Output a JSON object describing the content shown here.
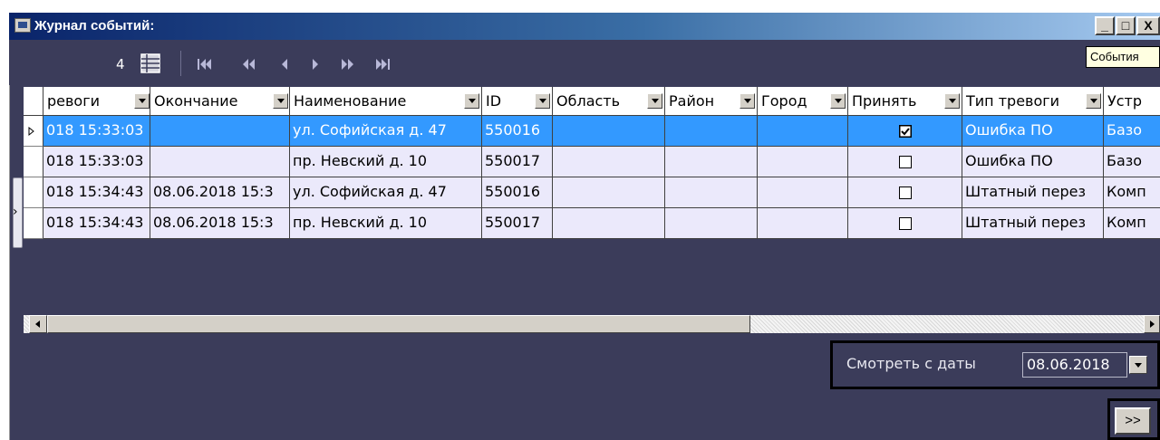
{
  "window": {
    "title": "Журнал событий:",
    "minimize_label": "_",
    "maximize_label": "□",
    "close_label": "X",
    "tooltip": "События"
  },
  "toolbar": {
    "record_count": "4",
    "nav_icons": [
      "first-record-icon",
      "prev-page-icon",
      "prev-record-icon",
      "next-record-icon",
      "next-page-icon",
      "last-record-icon"
    ]
  },
  "columns": [
    {
      "label": "ревоги",
      "has_dropdown": true
    },
    {
      "label": "Окончание",
      "has_dropdown": true
    },
    {
      "label": "Наименование",
      "has_dropdown": true
    },
    {
      "label": "ID",
      "has_dropdown": true
    },
    {
      "label": "Область",
      "has_dropdown": true
    },
    {
      "label": "Район",
      "has_dropdown": true
    },
    {
      "label": "Город",
      "has_dropdown": true
    },
    {
      "label": "Принять",
      "has_dropdown": true
    },
    {
      "label": "Тип тревоги",
      "has_dropdown": true
    },
    {
      "label": "Устр",
      "has_dropdown": false
    }
  ],
  "rows": [
    {
      "selected": true,
      "cells": [
        "018 15:33:03",
        "",
        "ул. Софийская д. 47",
        "550016",
        "",
        "",
        "",
        "",
        "Ошибка ПО",
        "Базо"
      ],
      "accepted": true
    },
    {
      "selected": false,
      "cells": [
        "018 15:33:03",
        "",
        "пр. Невский д. 10",
        "550017",
        "",
        "",
        "",
        "",
        "Ошибка ПО",
        "Базо"
      ],
      "accepted": false
    },
    {
      "selected": false,
      "cells": [
        "018 15:34:43",
        "08.06.2018 15:3",
        "ул. Софийская д. 47",
        "550016",
        "",
        "",
        "",
        "",
        "Штатный перез",
        "Комп"
      ],
      "accepted": false
    },
    {
      "selected": false,
      "cells": [
        "018 15:34:43",
        "08.06.2018 15:3",
        "пр. Невский д. 10",
        "550017",
        "",
        "",
        "",
        "",
        "Штатный перез",
        "Комп"
      ],
      "accepted": false
    }
  ],
  "filter": {
    "label": "Смотреть с даты",
    "date_value": "08.06.2018"
  },
  "expand_button": {
    "label": ">>"
  },
  "colors": {
    "background": "#3b3c5a",
    "selected_row": "#3399ff",
    "row": "#ebe9fb",
    "title_gradient_start": "#0a246a"
  }
}
